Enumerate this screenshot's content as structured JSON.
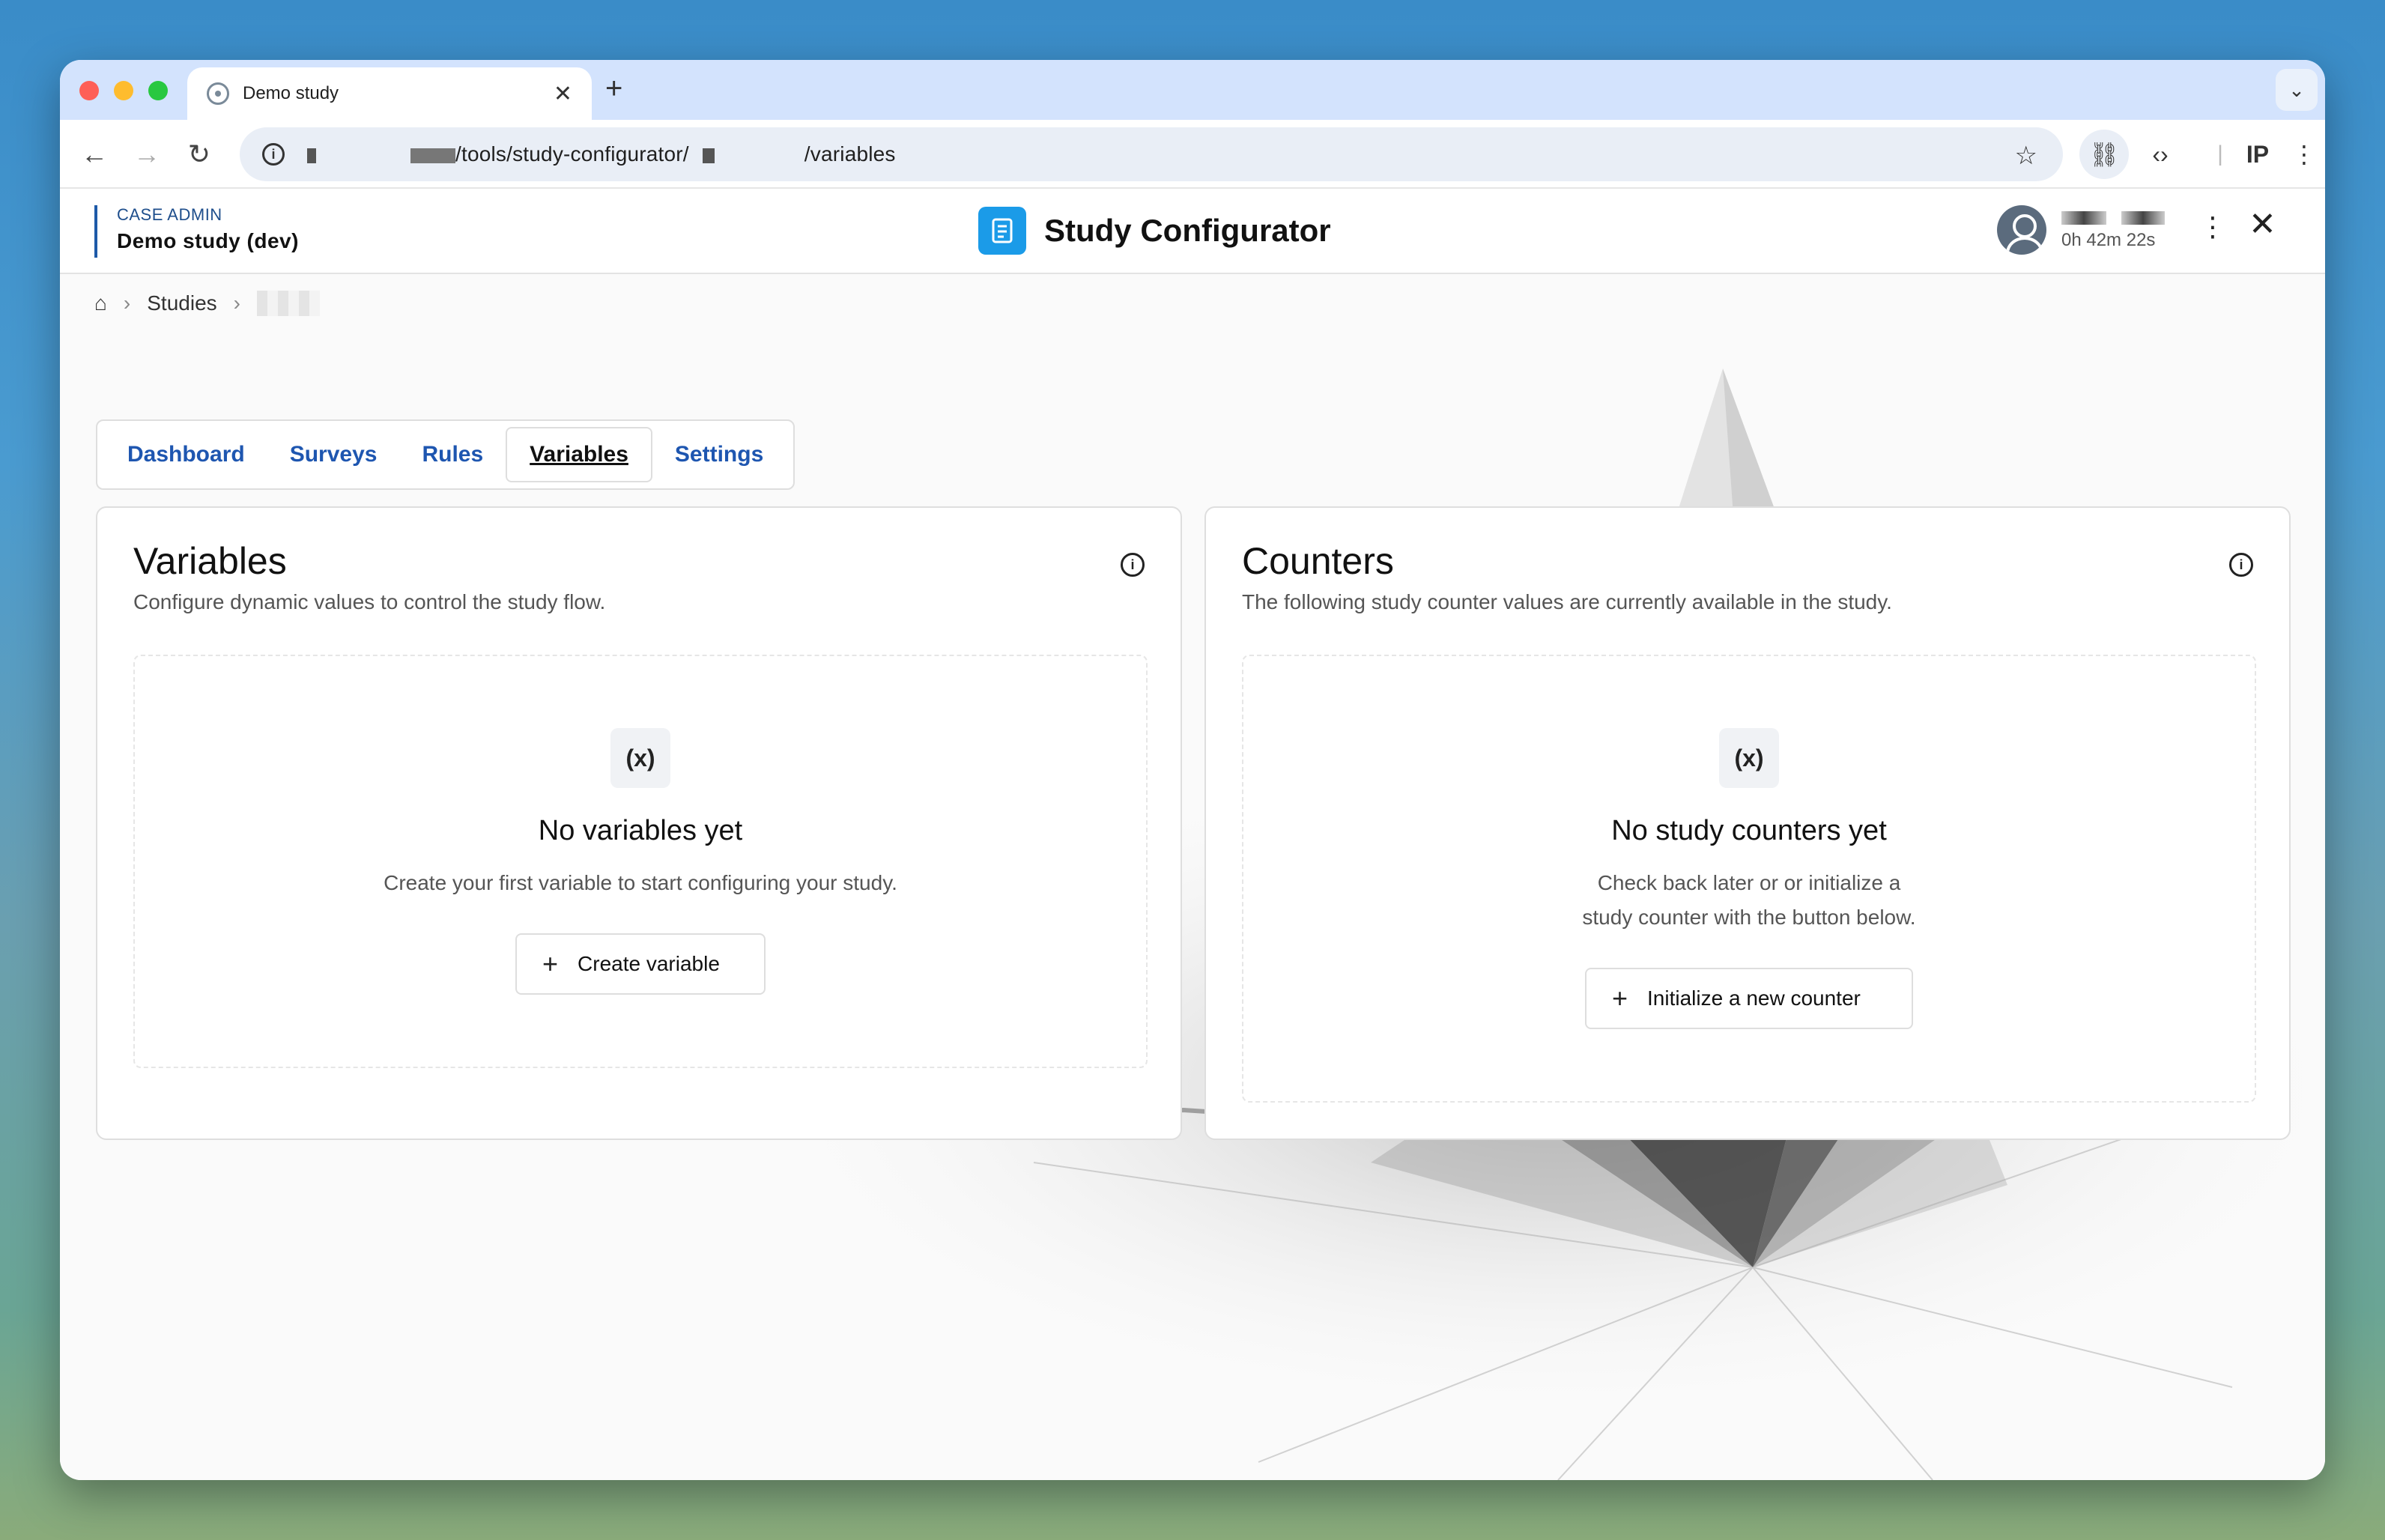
{
  "browser": {
    "tab_title": "Demo study",
    "url_part1": "/tools/study-configurator/",
    "url_part2": "/variables"
  },
  "header": {
    "role": "CASE ADMIN",
    "study_name": "Demo study (dev)",
    "app_title": "Study Configurator",
    "session_timer": "0h 42m 22s"
  },
  "breadcrumb": {
    "studies": "Studies"
  },
  "tabs": [
    {
      "label": "Dashboard"
    },
    {
      "label": "Surveys"
    },
    {
      "label": "Rules"
    },
    {
      "label": "Variables"
    },
    {
      "label": "Settings"
    }
  ],
  "active_tab": "Variables",
  "variables": {
    "title": "Variables",
    "description": "Configure dynamic values to control the study flow.",
    "empty_icon": "(x)",
    "empty_title": "No variables yet",
    "empty_text": "Create your first variable to start configuring your study.",
    "button": "Create variable"
  },
  "counters": {
    "title": "Counters",
    "description": "The following study counter values are currently available in the study.",
    "empty_icon": "(x)",
    "empty_title": "No study counters yet",
    "empty_text_line1": "Check back later or or initialize a",
    "empty_text_line2": "study counter with the button below.",
    "button": "Initialize a new counter"
  },
  "colors": {
    "link": "#1e56b0",
    "brand": "#1b9be8",
    "tabstrip": "#d3e3fd"
  }
}
